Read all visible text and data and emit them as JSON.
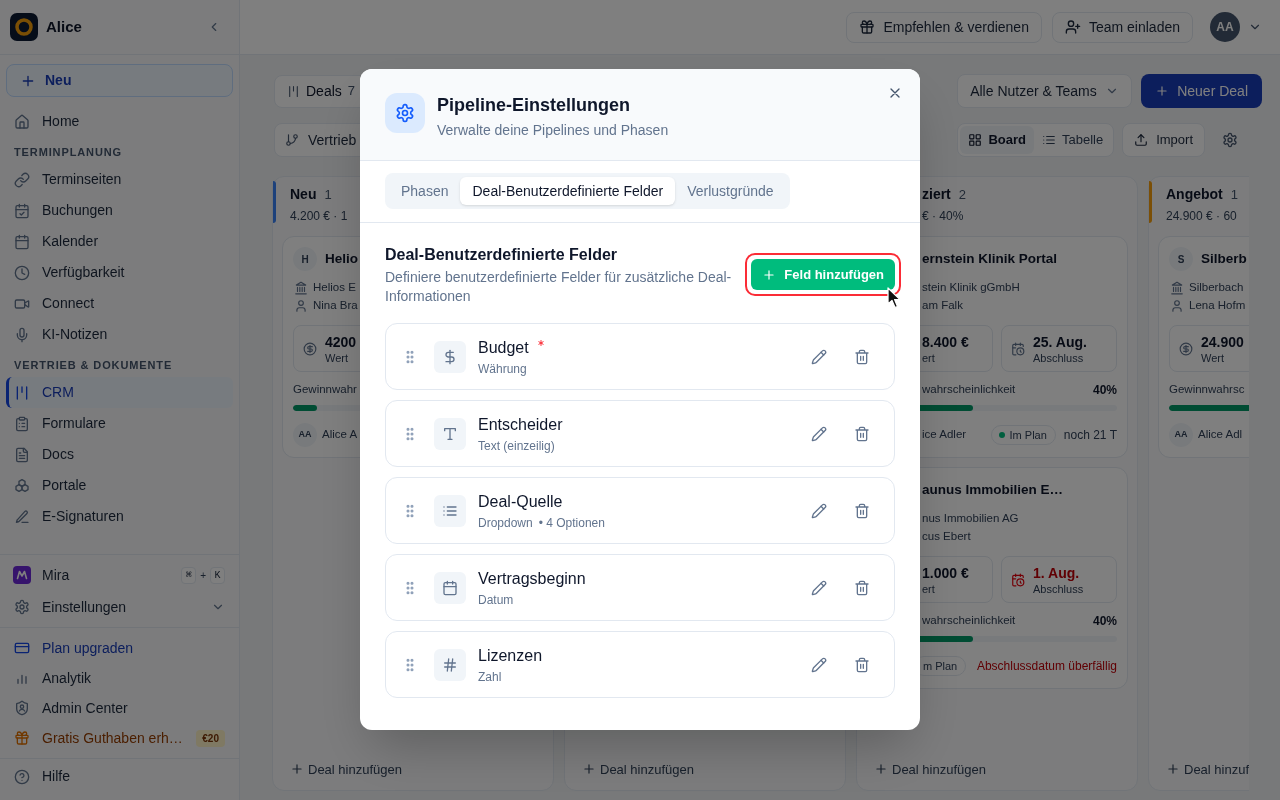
{
  "sidebar": {
    "workspace": "Alice",
    "new_button": "Neu",
    "sections": [
      {
        "items": [
          {
            "label": "Home",
            "selected": false
          }
        ]
      },
      {
        "heading": "TERMINPLANUNG",
        "items": [
          {
            "label": "Terminseiten",
            "selected": false
          },
          {
            "label": "Buchungen",
            "selected": false
          },
          {
            "label": "Kalender",
            "selected": false
          },
          {
            "label": "Verfügbarkeit",
            "selected": false
          },
          {
            "label": "Connect",
            "selected": false
          },
          {
            "label": "KI-Notizen",
            "selected": false
          }
        ]
      },
      {
        "heading": "VERTRIEB & DOKUMENTE",
        "items": [
          {
            "label": "CRM",
            "selected": true
          },
          {
            "label": "Formulare",
            "selected": false
          },
          {
            "label": "Docs",
            "selected": false
          },
          {
            "label": "Portale",
            "selected": false
          },
          {
            "label": "E-Signaturen",
            "selected": false
          }
        ]
      }
    ],
    "assistant": {
      "label": "Mira",
      "shortcut_keys": [
        "⌘",
        "K"
      ],
      "shortcut_joiner": "+"
    },
    "settings": {
      "label": "Einstellungen",
      "expanded": false
    },
    "links": [
      {
        "kind": "upgrade",
        "label": "Plan upgraden"
      },
      {
        "kind": "plain",
        "label": "Analytik"
      },
      {
        "kind": "plain",
        "label": "Admin Center"
      },
      {
        "kind": "promo",
        "label": "Gratis Guthaben erh…",
        "badge": "€20"
      }
    ],
    "help": "Hilfe"
  },
  "top_bar": {
    "buttons": [
      "Empfehlen & verdienen",
      "Team einladen"
    ],
    "avatar": "AA"
  },
  "toolbar": {
    "title": "Deals",
    "count": "7",
    "pipeline": "Vertrieb",
    "owner_filter": "Alle Nutzer & Teams",
    "new_deal": "Neuer Deal",
    "views": [
      {
        "label": "Board",
        "selected": true
      },
      {
        "label": "Tabelle",
        "selected": false
      }
    ],
    "import": "Import"
  },
  "board": {
    "columns": [
      {
        "title": "Neu",
        "count": "1",
        "summary": "4.200 € · 1",
        "color": "#1d417b",
        "cards": [
          {
            "avatar": "H",
            "title": "Helio",
            "company": "Helios E",
            "contact": "Nina Bra",
            "value": "4200",
            "value_label": "Wert",
            "probability_label": "Gewinnwahr",
            "level": 0.1,
            "owner_initials": "AA",
            "owner": "Alice A"
          }
        ],
        "add_label": "Deal hinzufügen"
      },
      {
        "add_label": "Deal hinzufügen"
      },
      {
        "title": "ziert",
        "count": "2",
        "summary": "€ · 40%",
        "cards": [
          {
            "title": "ernstein Klinik Portal",
            "company": "stein Klinik gGmbH",
            "contact": "am Falk",
            "value": "8.400 €",
            "value_label": "ert",
            "close_date": "25. Aug.",
            "close_label": "Abschluss",
            "overdue": false,
            "probability_label": "wahrscheinlichkeit",
            "probability": "40%",
            "level": 0.4,
            "owner": "ice Adler",
            "status": {
              "label": "Im Plan",
              "dot": true
            },
            "note": {
              "text": "noch 21 T",
              "alert": false
            }
          },
          {
            "title": "aunus Immobilien E…",
            "company": "nus Immobilien AG",
            "contact": "cus Ebert",
            "value": "1.000 €",
            "value_label": "ert",
            "close_date": "1. Aug.",
            "close_label": "Abschluss",
            "overdue": true,
            "probability_label": "wahrscheinlichkeit",
            "probability": "40%",
            "level": 0.4,
            "status": {
              "label": "m Plan",
              "dot": false
            },
            "note": {
              "text": "Abschlussdatum überfällig",
              "alert": true
            }
          }
        ],
        "add_label": "Deal hinzufügen"
      },
      {
        "title": "Angebot",
        "count": "1",
        "summary": "24.900 € · 60",
        "color": "#7b4f06",
        "cards": [
          {
            "avatar": "S",
            "title": "Silberb",
            "company": "Silberbach",
            "contact": "Lena Hofm",
            "value": "24.900",
            "value_label": "Wert",
            "probability_label": "Gewinnwahrsc",
            "level": 0.6,
            "owner_initials": "AA",
            "owner": "Alice Adl"
          }
        ],
        "add_label": "Deal hinzuf"
      }
    ]
  },
  "dialog": {
    "title": "Pipeline-Einstellungen",
    "subtitle": "Verwalte deine Pipelines und Phasen",
    "tabs": [
      {
        "label": "Phasen",
        "selected": false
      },
      {
        "label": "Deal-Benutzerdefinierte Felder",
        "selected": true
      },
      {
        "label": "Verlustgründe",
        "selected": false
      }
    ],
    "section_title": "Deal-Benutzerdefinierte Felder",
    "section_description": "Definiere benutzerdefinierte Felder für zusätzliche Deal-Informationen",
    "add_button": {
      "label": "Feld hinzufügen",
      "highlighted": true,
      "pointer": true
    },
    "fields": [
      {
        "name": "Budget",
        "kind": "currency",
        "type_label": "Währung",
        "required": true
      },
      {
        "name": "Entscheider",
        "kind": "text",
        "type_label": "Text (einzeilig)",
        "required": false
      },
      {
        "name": "Deal-Quelle",
        "kind": "dropdown",
        "type_label": "Dropdown",
        "options": "• 4 Optionen",
        "required": false
      },
      {
        "name": "Vertragsbeginn",
        "kind": "date",
        "type_label": "Datum",
        "required": false
      },
      {
        "name": "Lizenzen",
        "kind": "number",
        "type_label": "Zahl",
        "required": false
      }
    ]
  }
}
